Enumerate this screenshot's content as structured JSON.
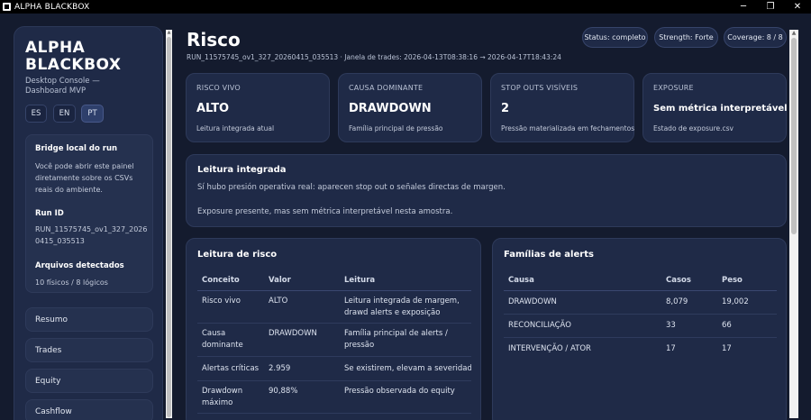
{
  "window": {
    "title": "ALPHA BLACKBOX",
    "minimize": "─",
    "maximize": "❐",
    "close": "✕"
  },
  "sidebar": {
    "brand": "ALPHA BLACKBOX",
    "subtitle": "Desktop Console — Dashboard MVP",
    "languages": [
      "ES",
      "EN",
      "PT"
    ],
    "active_language": "PT",
    "bridge_title": "Bridge local do run",
    "bridge_text": "Você pode abrir este painel diretamente sobre os CSVs reais do ambiente.",
    "run_id_title": "Run ID",
    "run_id": "RUN_11575745_ov1_327_20260415_035513",
    "files_title": "Arquivos detectados",
    "files_text": "10 físicos / 8 lógicos",
    "nav": [
      "Resumo",
      "Trades",
      "Equity",
      "Cashflow"
    ]
  },
  "header": {
    "title": "Risco",
    "meta": "RUN_11575745_ov1_327_20260415_035513 · Janela de trades: 2026-04-13T08:38:16 → 2026-04-17T18:43:24",
    "status": "Status: completo",
    "strength": "Strength: Forte",
    "coverage": "Coverage: 8 / 8"
  },
  "stats": [
    {
      "label": "RISCO VIVO",
      "value": "ALTO",
      "caption": "Leitura integrada atual"
    },
    {
      "label": "CAUSA DOMINANTE",
      "value": "DRAWDOWN",
      "caption": "Família principal de pressão"
    },
    {
      "label": "STOP OUTS VISÍVEIS",
      "value": "2",
      "caption": "Pressão materializada em fechamentos"
    },
    {
      "label": "EXPOSURE",
      "value": "Sem métrica interpretável",
      "caption": "Estado de exposure.csv"
    }
  ],
  "integrated": {
    "title": "Leitura integrada",
    "line1": "Sí hubo presión operativa real: aparecen stop out o señales directas de margen.",
    "line2": "Exposure presente, mas sem métrica interpretável nesta amostra."
  },
  "risk_table": {
    "title": "Leitura de risco",
    "headers": [
      "Conceito",
      "Valor",
      "Leitura"
    ],
    "rows": [
      [
        "Risco vivo",
        "ALTO",
        "Leitura integrada de margem, drawd alerts e exposição"
      ],
      [
        "Causa dominante",
        "DRAWDOWN",
        "Família principal de alerts / pressão"
      ],
      [
        "Alertas críticas",
        "2.959",
        "Se existirem, elevam a severidade do"
      ],
      [
        "Drawdown máximo",
        "90,88%",
        "Pressão observada do equity"
      ]
    ]
  },
  "alerts_table": {
    "title": "Famílias de alerts",
    "headers": [
      "Causa",
      "Casos",
      "Peso"
    ],
    "rows": [
      [
        "DRAWDOWN",
        "8,079",
        "19,002"
      ],
      [
        "RECONCILIAÇÃO",
        "33",
        "66"
      ],
      [
        "INTERVENÇÃO / ATOR",
        "17",
        "17"
      ]
    ]
  },
  "colors": {
    "background": "#141b2e",
    "card": "#1f2a47",
    "accent": "#2e3f6b"
  }
}
